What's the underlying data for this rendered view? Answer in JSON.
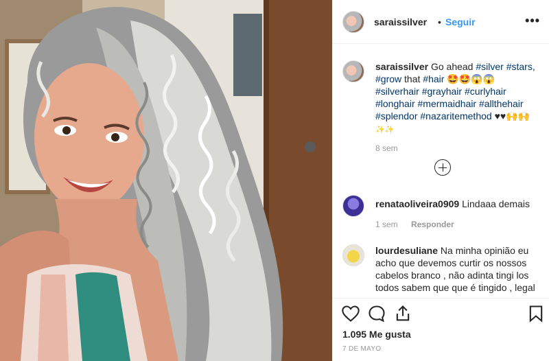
{
  "post": {
    "username": "saraissilver",
    "follow_label": "Seguir",
    "more_label": "•••"
  },
  "caption": {
    "username": "saraissilver",
    "text_intro": "Go ahead",
    "tags": [
      "#silver",
      "#stars",
      "#grow",
      "#hair",
      "#silverhair",
      "#grayhair",
      "#curlyhair",
      "#longhair",
      "#mermaidhair",
      "#allthehair",
      "#splendor",
      "#nazaritemethod"
    ],
    "text_comma": ",",
    "text_that": "that",
    "emoji_line1": "🤩🤩😱😱",
    "emoji_line2": "♥♥🙌🙌",
    "emoji_line3": "✨✨",
    "time": "8 sem"
  },
  "comments": [
    {
      "username": "renataoliveira0909",
      "text": "Lindaaa demais",
      "time": "1 sem",
      "reply_label": "Responder"
    },
    {
      "username": "lourdesuliane",
      "text": "Na minha opinião eu acho que devemos curtir os nossos cabelos branco , não adinta tingi los todos sabem que que é tingido , legal"
    }
  ],
  "footer": {
    "likes": "1.095 Me gusta",
    "date": "7 DE MAYO"
  },
  "colors": {
    "link": "#3897f0",
    "hashtag": "#003569",
    "muted": "#999999",
    "text": "#262626"
  },
  "icons": [
    "heart-icon",
    "comment-icon",
    "share-icon",
    "bookmark-icon",
    "add-comment-icon",
    "more-icon"
  ]
}
